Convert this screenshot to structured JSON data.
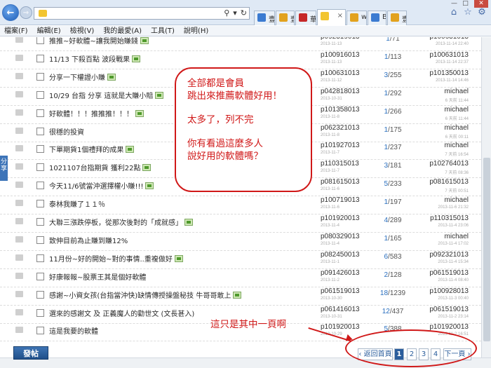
{
  "browser": {
    "nav": {
      "back": "←",
      "forward": "→"
    },
    "address_buttons": [
      "⚲",
      "▾",
      "↻"
    ],
    "tabs": [
      {
        "label": "壹...",
        "color": "#3b7bd1"
      },
      {
        "label": "壹...",
        "color": "#e2a21e"
      },
      {
        "label": "華...",
        "color": "#c62828"
      },
      {
        "label": "",
        "color": "#f2c531",
        "active": true
      },
      {
        "label": "w...",
        "color": "#e2a21e"
      },
      {
        "label": "Bi...",
        "color": "#3b7bd1"
      },
      {
        "label": "壹...",
        "color": "#e2a21e"
      }
    ],
    "toolbar_icons": [
      "home-icon",
      "star-icon",
      "gear-icon"
    ],
    "window_buttons": [
      "—",
      "□",
      "✕"
    ]
  },
  "menu": [
    "檔案(F)",
    "編輯(E)",
    "檢視(V)",
    "我的最愛(A)",
    "工具(T)",
    "說明(H)"
  ],
  "threads": [
    {
      "title": "推推~好軟體~讓我開始賺錢",
      "att": true,
      "author": "p092319013",
      "date": "2013-11-13",
      "replies": "1",
      "views": "71",
      "last": "p100631013",
      "last_date": "2013-11-14 22:40"
    },
    {
      "title": "11/13 下殺百點 波段戰果",
      "att": true,
      "author": "p100916013",
      "date": "2013-11-13",
      "replies": "1",
      "views": "113",
      "last": "p100631013",
      "last_date": "2013-11-14 22:37"
    },
    {
      "title": "分享一下權證小賺",
      "att": true,
      "author": "p100631013",
      "date": "2013-11-12",
      "replies": "3",
      "views": "255",
      "last": "p101350013",
      "last_date": "2013-11-14 14:46"
    },
    {
      "title": "10/29 台指 分享 這就是大賺小賠",
      "att": true,
      "author": "p042818013",
      "date": "2013-10-31",
      "replies": "1",
      "views": "292",
      "last": "michael",
      "last_date": "6 天前 11:44"
    },
    {
      "title": "好軟體！！！推推推！！！",
      "att": true,
      "author": "p101358013",
      "date": "2013-11-8",
      "replies": "1",
      "views": "266",
      "last": "michael",
      "last_date": "6 天前 11:44"
    },
    {
      "title": "很穩的投資",
      "att": false,
      "author": "p062321013",
      "date": "2013-11-8",
      "replies": "1",
      "views": "175",
      "last": "michael",
      "last_date": "6 天前 00:11"
    },
    {
      "title": "下單期貨1個禮拜的成果",
      "att": true,
      "author": "p101927013",
      "date": "2013-11-7",
      "replies": "1",
      "views": "237",
      "last": "michael",
      "last_date": "7 天前 16:54"
    },
    {
      "title": "1021107台指期貨 獲利22點",
      "att": true,
      "author": "p110315013",
      "date": "2013-11-7",
      "replies": "3",
      "views": "181",
      "last": "p102764013",
      "last_date": "7 天前 08:36"
    },
    {
      "title": "今天11/6號當沖選擇權小賺!!!",
      "att": true,
      "author": "p081615013",
      "date": "2013-11-6",
      "replies": "5",
      "views": "233",
      "last": "p081615013",
      "last_date": "7 天前 00:51"
    },
    {
      "title": "泰林我賺了１１％",
      "att": false,
      "author": "p100719013",
      "date": "2013-11-6",
      "replies": "1",
      "views": "197",
      "last": "michael",
      "last_date": "2013-11-6 21:32"
    },
    {
      "title": "大聯三漲跌停板，從那次後對的「成就感」",
      "att": true,
      "author": "p101920013",
      "date": "2013-11-4",
      "replies": "4",
      "views": "289",
      "last": "p110315013",
      "last_date": "2013-11-4 23:06"
    },
    {
      "title": "致伸目前為止賺到賺12%",
      "att": false,
      "author": "p080329013",
      "date": "2013-11-4",
      "replies": "1",
      "views": "165",
      "last": "michael",
      "last_date": "2013-11-4 17:02"
    },
    {
      "title": "11月份~好的開始~對的事情..重複做好",
      "att": true,
      "author": "p082450013",
      "date": "2013-11-1",
      "replies": "6",
      "views": "583",
      "last": "p092321013",
      "last_date": "2013-11-4 15:34"
    },
    {
      "title": "好康報報~股票王其是個好軟體",
      "att": false,
      "author": "p091426013",
      "date": "2013-11-2",
      "replies": "2",
      "views": "128",
      "last": "p061519013",
      "last_date": "2013-11-4 08:40"
    },
    {
      "title": "感謝~小資女孩(台指當沖快)缺情傳授操盤秘技 牛哥哥敢上",
      "att": true,
      "author": "p061519013",
      "date": "2013-10-30",
      "replies": "18",
      "views": "1239",
      "last": "p100928013",
      "last_date": "2013-11-3 00:40"
    },
    {
      "title": "選來的感謝文 及 正義魔人的勸世文 (文長甚入)",
      "att": false,
      "author": "p061416013",
      "date": "2013-10-31",
      "replies": "12",
      "views": "437",
      "last": "p061519013",
      "last_date": "2013-11-2 23:14"
    },
    {
      "title": "這是我要的軟體",
      "att": false,
      "author": "p101920013",
      "date": "2013-10-29",
      "replies": "5",
      "views": "388",
      "last": "p101920013",
      "last_date": "2013-11-2 16:51"
    }
  ],
  "share_tab": "分享",
  "post_button": "發帖",
  "pager": {
    "prev": "‹ 返回首頁",
    "pages": [
      "1",
      "2",
      "3",
      "4"
    ],
    "next": "下一頁 ›"
  },
  "annotation": {
    "lines": [
      "全部都是會員",
      "跳出來推薦軟體好用！",
      "",
      "太多了，列不完",
      "",
      "你有看過這麼多人",
      "說好用的軟體嗎？"
    ],
    "circle_note": "這只是其中一頁啊"
  }
}
